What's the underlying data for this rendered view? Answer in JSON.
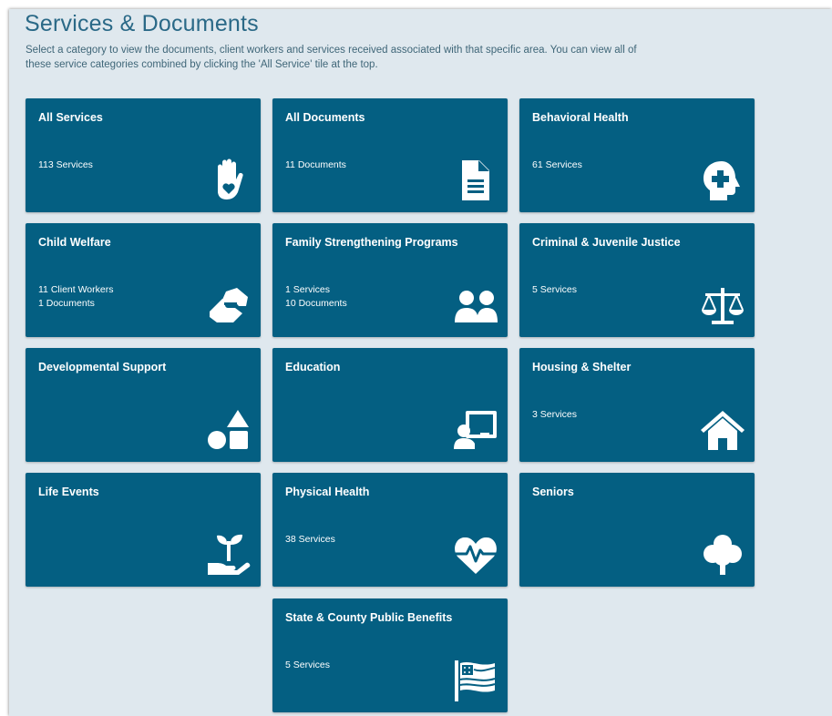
{
  "header": {
    "title": "Services & Documents",
    "description": "Select a category to view the documents, client workers and services received associated with that specific area. You can view all of these service categories combined by clicking the 'All Service' tile at the top."
  },
  "tiles": [
    {
      "title": "All Services",
      "lines": [
        "113 Services"
      ],
      "icon": "hand-heart-icon"
    },
    {
      "title": "All Documents",
      "lines": [
        "11 Documents"
      ],
      "icon": "document-icon"
    },
    {
      "title": "Behavioral Health",
      "lines": [
        "61 Services"
      ],
      "icon": "head-medical-icon"
    },
    {
      "title": "Child Welfare",
      "lines": [
        "11 Client Workers",
        "1 Documents"
      ],
      "icon": "handshake-icon"
    },
    {
      "title": "Family Strengthening Programs",
      "lines": [
        "1 Services",
        "10 Documents"
      ],
      "icon": "users-icon"
    },
    {
      "title": "Criminal & Juvenile Justice",
      "lines": [
        "5 Services"
      ],
      "icon": "scale-icon"
    },
    {
      "title": "Developmental Support",
      "lines": [],
      "icon": "shapes-icon"
    },
    {
      "title": "Education",
      "lines": [],
      "icon": "teacher-board-icon"
    },
    {
      "title": "Housing & Shelter",
      "lines": [
        "3 Services"
      ],
      "icon": "house-icon"
    },
    {
      "title": "Life Events",
      "lines": [],
      "icon": "seedling-hand-icon"
    },
    {
      "title": "Physical Health",
      "lines": [
        "38 Services"
      ],
      "icon": "heart-pulse-icon"
    },
    {
      "title": "Seniors",
      "lines": [],
      "icon": "tree-icon"
    },
    {
      "title": "State & County Public Benefits",
      "lines": [
        "5 Services"
      ],
      "icon": "flag-icon"
    }
  ],
  "colors": {
    "tile": "#045f82",
    "panel": "#dfe8ee",
    "title": "#2a6987"
  }
}
